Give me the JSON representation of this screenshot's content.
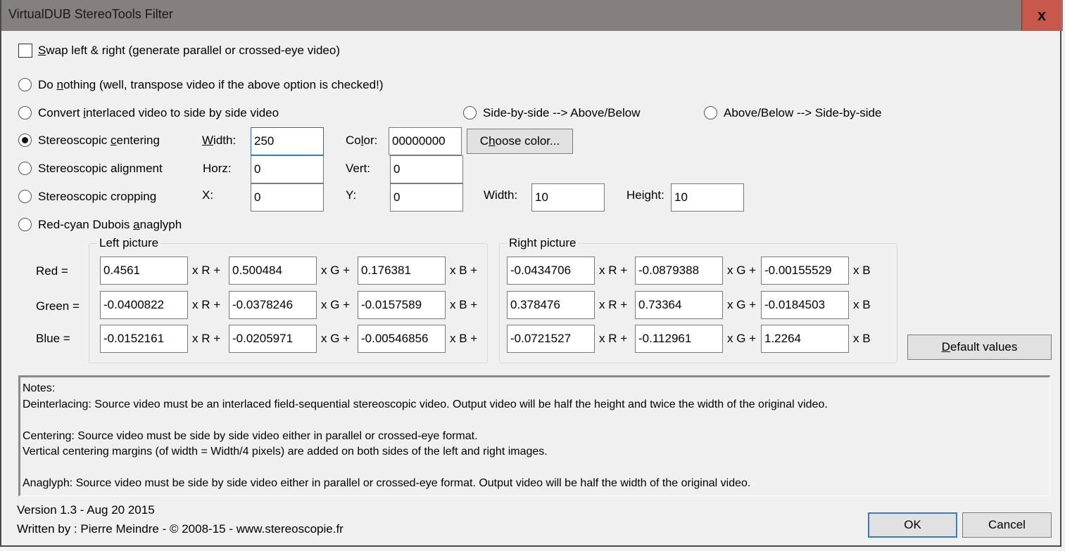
{
  "window": {
    "title": "VirtualDUB StereoTools Filter",
    "close_label": "x"
  },
  "options": {
    "swap": {
      "before": "",
      "accel": "S",
      "after": "wap left & right (generate parallel or crossed-eye video)",
      "checked": false
    },
    "do_nothing": {
      "before": "Do ",
      "accel": "n",
      "after": "othing (well, transpose video if the above option is checked!)",
      "selected": false
    },
    "convert_interlaced": {
      "before": "Convert ",
      "accel": "i",
      "after": "nterlaced video to side by side video",
      "selected": false
    },
    "sbs_to_ab": {
      "label": "Side-by-side --> Above/Below",
      "selected": false
    },
    "ab_to_sbs": {
      "label": "Above/Below --> Side-by-side",
      "selected": false
    },
    "centering": {
      "before": "Stereoscopic ",
      "accel": "c",
      "after": "entering",
      "selected": true
    },
    "alignment": {
      "label": "Stereoscopic alignment",
      "selected": false
    },
    "cropping": {
      "before": "Stereoscopic croppin",
      "accel": "g",
      "after": "",
      "selected": false
    },
    "anaglyph": {
      "before": "Red-cyan Dubois ",
      "accel": "a",
      "after": "naglyph",
      "selected": false
    }
  },
  "centering": {
    "width_label_accel": "W",
    "width_label_rest": "idth:",
    "width_value": "250",
    "color_label_before": "Co",
    "color_label_accel": "l",
    "color_label_after": "or:",
    "color_value": "00000000",
    "choose_color_before": "C",
    "choose_color_accel": "h",
    "choose_color_after": "oose color..."
  },
  "alignment": {
    "horz_label": "Horz:",
    "horz_value": "0",
    "vert_label": "Vert:",
    "vert_value": "0"
  },
  "cropping": {
    "x_label": "X:",
    "x_value": "0",
    "y_label": "Y:",
    "y_value": "0",
    "width_label": "Width:",
    "width_value": "10",
    "height_label": "Height:",
    "height_value": "10"
  },
  "anaglyph": {
    "left_title": "Left picture",
    "right_title": "Right picture",
    "row_labels": [
      "Red =",
      "Green =",
      "Blue ="
    ],
    "left_suffixes": [
      "x R +",
      "x G +",
      "x B +"
    ],
    "right_suffixes": [
      "x R +",
      "x G +",
      "x B"
    ],
    "left": [
      [
        "0.4561",
        "0.500484",
        "0.176381"
      ],
      [
        "-0.0400822",
        "-0.0378246",
        "-0.0157589"
      ],
      [
        "-0.0152161",
        "-0.0205971",
        "-0.00546856"
      ]
    ],
    "right": [
      [
        "-0.0434706",
        "-0.0879388",
        "-0.00155529"
      ],
      [
        "0.378476",
        "0.73364",
        "-0.0184503"
      ],
      [
        "-0.0721527",
        "-0.112961",
        "1.2264"
      ]
    ],
    "default_before": "",
    "default_accel": "D",
    "default_after": "efault values"
  },
  "notes": {
    "text": "Notes:\nDeinterlacing: Source video must be an interlaced field-sequential stereoscopic video. Output video will be half the height and twice the width of the original video.\n\nCentering: Source video must be side by side video either in parallel or crossed-eye format.\nVertical centering margins (of width = Width/4 pixels) are added on both sides of the left and right images.\n\nAnaglyph: Source video must be side by side video either in parallel or crossed-eye format. Output video will be half the width of the original video."
  },
  "footer": {
    "version": "Version 1.3 - Aug 20 2015",
    "author": "Written by : Pierre Meindre - © 2008-15 - www.stereoscopie.fr",
    "ok_label": "OK",
    "cancel_label": "Cancel"
  }
}
